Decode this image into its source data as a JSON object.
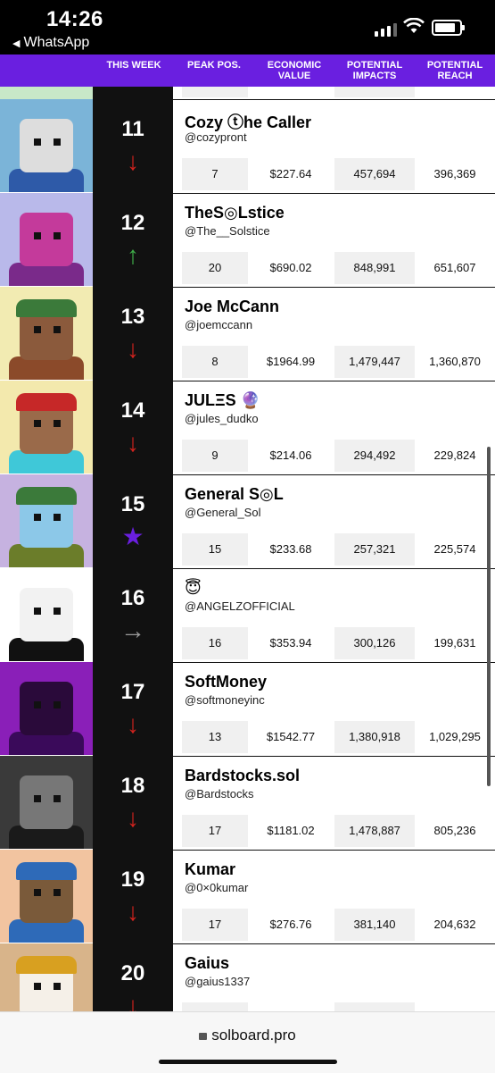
{
  "status": {
    "time": "14:26",
    "back_app": "WhatsApp"
  },
  "headers": {
    "this_week": "THIS WEEK",
    "peak": "PEAK POS.",
    "econ": "ECONOMIC VALUE",
    "impacts": "POTENTIAL IMPACTS",
    "reach": "POTENTIAL REACH"
  },
  "rows": [
    {
      "rank": "11",
      "trend": "↓",
      "trend_color": "#d2231e",
      "name": "Cozy ⓣhe Caller",
      "handle": "@cozypront",
      "peak": "7",
      "econ": "$227.64",
      "impacts": "457,694",
      "reach": "396,369",
      "avatar_bg": "#7bb4d8",
      "avatar_fg": "#dddddd",
      "avatar_body": "#2e5aa8"
    },
    {
      "rank": "12",
      "trend": "↑",
      "trend_color": "#3fae49",
      "name": "TheS◎Lstice",
      "handle": "@The__Solstice",
      "peak": "20",
      "econ": "$690.02",
      "impacts": "848,991",
      "reach": "651,607",
      "avatar_bg": "#b9b9ea",
      "avatar_fg": "#c43a9b",
      "avatar_body": "#7a2a8a"
    },
    {
      "rank": "13",
      "trend": "↓",
      "trend_color": "#d2231e",
      "name": "Joe McCann",
      "handle": "@joemccann",
      "peak": "8",
      "econ": "$1964.99",
      "impacts": "1,479,447",
      "reach": "1,360,870",
      "avatar_bg": "#f2ebb2",
      "avatar_fg": "#8b5a3c",
      "avatar_body": "#8b4a2a",
      "avatar_hat": "#3b7a3a"
    },
    {
      "rank": "14",
      "trend": "↓",
      "trend_color": "#d2231e",
      "name": "JULΞS 🔮",
      "handle": "@jules_dudko",
      "peak": "9",
      "econ": "$214.06",
      "impacts": "294,492",
      "reach": "229,824",
      "avatar_bg": "#f3e9ad",
      "avatar_fg": "#9a6a4a",
      "avatar_body": "#3fc8d8",
      "avatar_hat": "#c62828"
    },
    {
      "rank": "15",
      "trend": "★",
      "trend_color": "#6a1fe0",
      "name": "General S◎L",
      "handle": "@General_Sol",
      "peak": "15",
      "econ": "$233.68",
      "impacts": "257,321",
      "reach": "225,574",
      "avatar_bg": "#c6b2e0",
      "avatar_fg": "#8cc8e8",
      "avatar_body": "#6b7d2a",
      "avatar_hat": "#3b7a3a"
    },
    {
      "rank": "16",
      "trend": "→",
      "trend_color": "#9a9a9a",
      "name": "😇",
      "handle": "@ANGELZOFFICIAL",
      "peak": "16",
      "econ": "$353.94",
      "impacts": "300,126",
      "reach": "199,631",
      "avatar_bg": "#ffffff",
      "avatar_fg": "#f2f2f2",
      "avatar_body": "#111111"
    },
    {
      "rank": "17",
      "trend": "↓",
      "trend_color": "#d2231e",
      "name": "SoftMoney",
      "handle": "@softmoneyinc",
      "peak": "13",
      "econ": "$1542.77",
      "impacts": "1,380,918",
      "reach": "1,029,295",
      "avatar_bg": "#8a1fb8",
      "avatar_fg": "#2a0a3a",
      "avatar_body": "#3a0a5a"
    },
    {
      "rank": "18",
      "trend": "↓",
      "trend_color": "#d2231e",
      "name": "Bardstocks.sol",
      "handle": "@Bardstocks",
      "peak": "17",
      "econ": "$1181.02",
      "impacts": "1,478,887",
      "reach": "805,236",
      "avatar_bg": "#3a3a3a",
      "avatar_fg": "#777777",
      "avatar_body": "#1a1a1a"
    },
    {
      "rank": "19",
      "trend": "↓",
      "trend_color": "#d2231e",
      "name": "Kumar",
      "handle": "@0×0kumar",
      "peak": "17",
      "econ": "$276.76",
      "impacts": "381,140",
      "reach": "204,632",
      "avatar_bg": "#f2c4a0",
      "avatar_fg": "#7a5a3a",
      "avatar_body": "#2e6ab8",
      "avatar_hat": "#2e6ab8"
    },
    {
      "rank": "20",
      "trend": "↓",
      "trend_color": "#d2231e",
      "name": "Gaius",
      "handle": "@gaius1337",
      "peak": "",
      "econ": "",
      "impacts": "",
      "reach": "",
      "avatar_bg": "#d8b48a",
      "avatar_fg": "#f5f0e8",
      "avatar_body": "#8a5a2a",
      "avatar_hat": "#d8a020"
    }
  ],
  "url": "solboard.pro"
}
